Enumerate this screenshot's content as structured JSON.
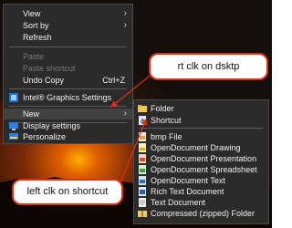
{
  "context_menu": {
    "items": [
      {
        "label": "View",
        "arrow": true,
        "disabled": false
      },
      {
        "label": "Sort by",
        "arrow": true,
        "disabled": false
      },
      {
        "label": "Refresh",
        "disabled": false
      },
      {
        "label": "Paste",
        "disabled": true
      },
      {
        "label": "Paste shortcut",
        "disabled": true
      },
      {
        "label": "Undo Copy",
        "shortcut": "Ctrl+Z",
        "disabled": false
      },
      {
        "label": "Intel® Graphics Settings",
        "icon": "intel-graphics-icon",
        "disabled": false
      },
      {
        "label": "New",
        "arrow": true,
        "disabled": false
      },
      {
        "label": "Display settings",
        "icon": "display-settings-icon",
        "disabled": false
      },
      {
        "label": "Personalize",
        "icon": "personalize-icon",
        "disabled": false
      }
    ]
  },
  "new_submenu": {
    "items": [
      {
        "label": "Folder",
        "icon": "folder-icon"
      },
      {
        "label": "Shortcut",
        "icon": "shortcut-icon"
      },
      {
        "label": "bmp File",
        "icon": "bmp-file-icon"
      },
      {
        "label": "OpenDocument Drawing",
        "icon": "odg-icon"
      },
      {
        "label": "OpenDocument Presentation",
        "icon": "odp-icon"
      },
      {
        "label": "OpenDocument Spreadsheet",
        "icon": "ods-icon"
      },
      {
        "label": "OpenDocument Text",
        "icon": "odt-icon"
      },
      {
        "label": "Rich Text Document",
        "icon": "rtf-icon"
      },
      {
        "label": "Text Document",
        "icon": "txt-icon"
      },
      {
        "label": "Compressed (zipped) Folder",
        "icon": "zip-folder-icon"
      }
    ]
  },
  "callouts": {
    "right_click": "rt clk on dsktp",
    "left_click": "left clk on shortcut"
  },
  "colors": {
    "menu_bg": "#2b2b2b",
    "callout_border": "#e03010",
    "arrow": "#e03010"
  }
}
